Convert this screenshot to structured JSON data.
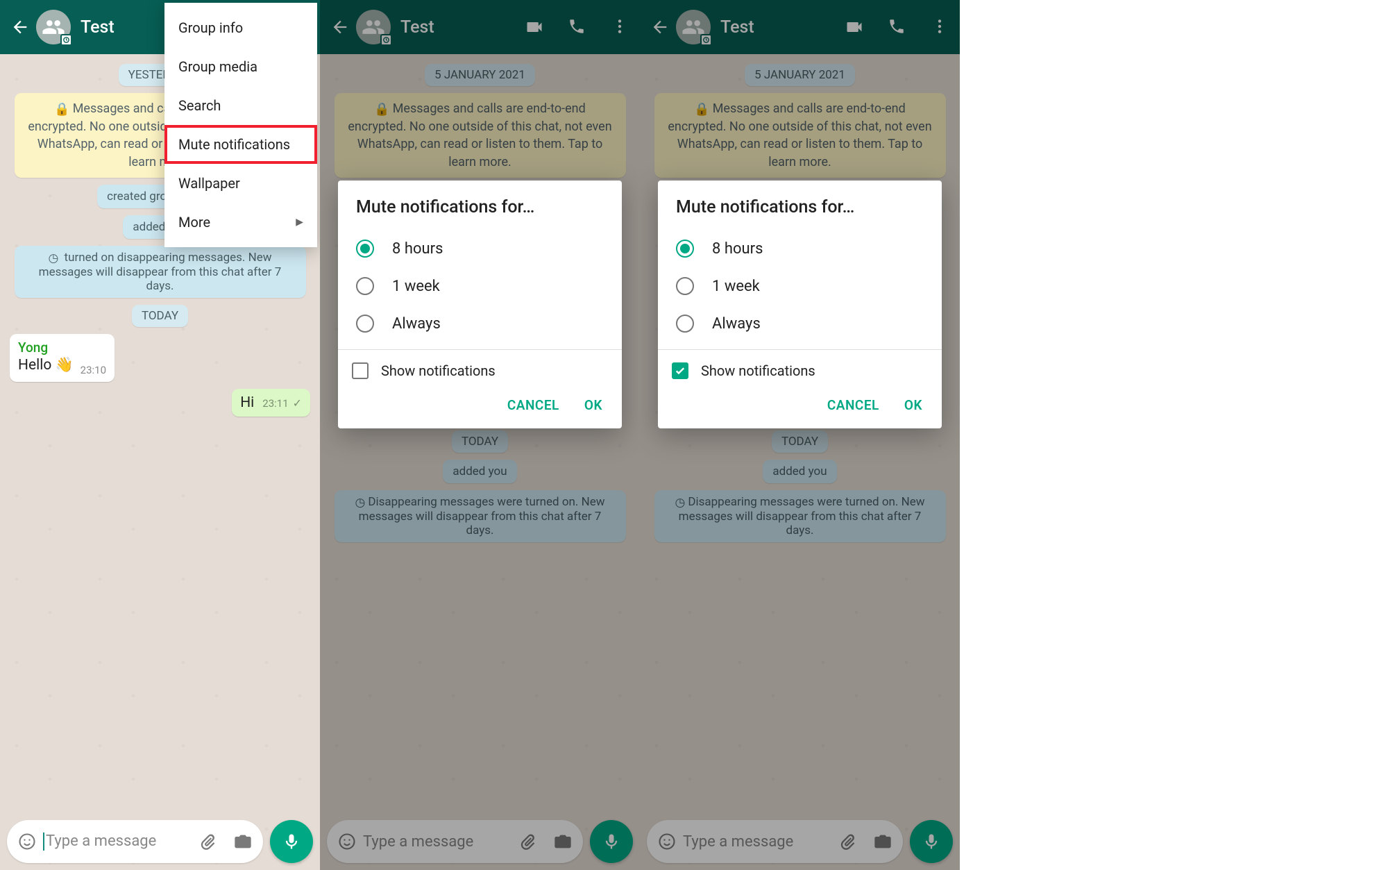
{
  "colors": {
    "header": "#075e54",
    "accent": "#00a884",
    "highlight": "#f02030"
  },
  "header": {
    "title": "Test"
  },
  "menu": {
    "items": [
      "Group info",
      "Group media",
      "Search",
      "Mute notifications",
      "Wallpaper",
      "More"
    ],
    "highlighted_index": 3
  },
  "chat1": {
    "date1": "YESTERDAY",
    "encryption": "Messages and calls are end-to-end encrypted. No one outside of this chat, not even WhatsApp, can read or listen to them. Tap to learn more.",
    "sys_created": "created group \"Test\"",
    "sys_added": "added you",
    "sys_disappear": "turned on disappearing messages. New messages will disappear from this chat after 7 days.",
    "date2": "TODAY",
    "msg_in": {
      "sender": "Yong",
      "text": "Hello 👋",
      "time": "23:10"
    },
    "msg_out": {
      "text": "Hi",
      "time": "23:11"
    },
    "input_placeholder": "Type a message"
  },
  "chat_bg": {
    "date": "5 JANUARY 2021",
    "encryption": "Messages and calls are end-to-end encrypted. No one outside of this chat, not even WhatsApp, can read or listen to them. Tap to learn more.",
    "sys_created": "created group \"Test\"",
    "date2": "TODAY",
    "sys_added": "added you",
    "sys_disappear": "Disappearing messages were turned on. New messages will disappear from this chat after 7 days.",
    "input_placeholder": "Type a message"
  },
  "dialog": {
    "title": "Mute notifications for…",
    "options": [
      "8 hours",
      "1 week",
      "Always"
    ],
    "selected_index": 0,
    "show_label": "Show notifications",
    "cancel": "CANCEL",
    "ok": "OK"
  },
  "dialog2_checked": true,
  "dialog1_checked": false
}
